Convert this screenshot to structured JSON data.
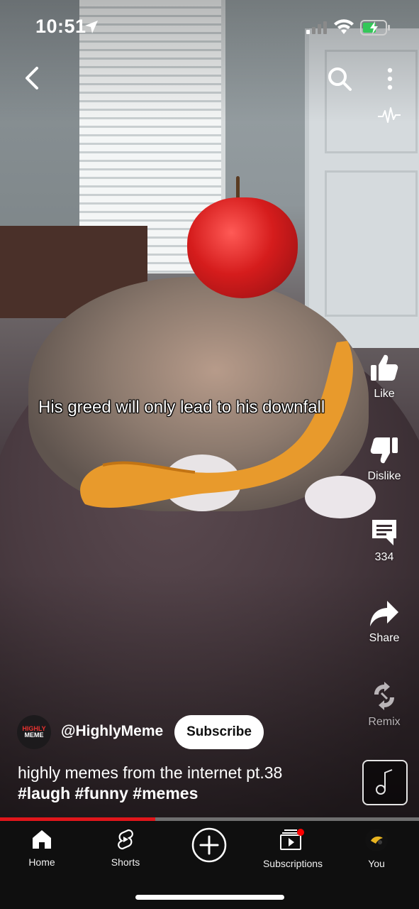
{
  "status_bar": {
    "time": "10:51"
  },
  "video": {
    "caption": "His greed will only lead to his downfall",
    "progress": 0.37
  },
  "actions": {
    "like_label": "Like",
    "dislike_label": "Dislike",
    "comments_count": "334",
    "share_label": "Share",
    "remix_label": "Remix"
  },
  "channel": {
    "avatar_line1": "HIGHLY",
    "avatar_line2": "MEME",
    "handle": "@HighlyMeme",
    "subscribe_label": "Subscribe"
  },
  "short": {
    "title": "highly memes from the internet pt.38",
    "hashtags": "#laugh #funny #memes"
  },
  "nav": {
    "items": [
      {
        "label": "Home",
        "icon": "home-icon"
      },
      {
        "label": "Shorts",
        "icon": "shorts-icon"
      },
      {
        "label": "",
        "icon": "create-plus-icon"
      },
      {
        "label": "Subscriptions",
        "icon": "subscriptions-icon"
      },
      {
        "label": "You",
        "icon": "profile-avatar-icon"
      }
    ]
  },
  "colors": {
    "progress_played": "#e0161b",
    "subscribe_bg": "#ffffff",
    "nav_bg": "#0f0f0f",
    "battery_charging": "#34c759",
    "notification_dot": "#ff0000"
  }
}
